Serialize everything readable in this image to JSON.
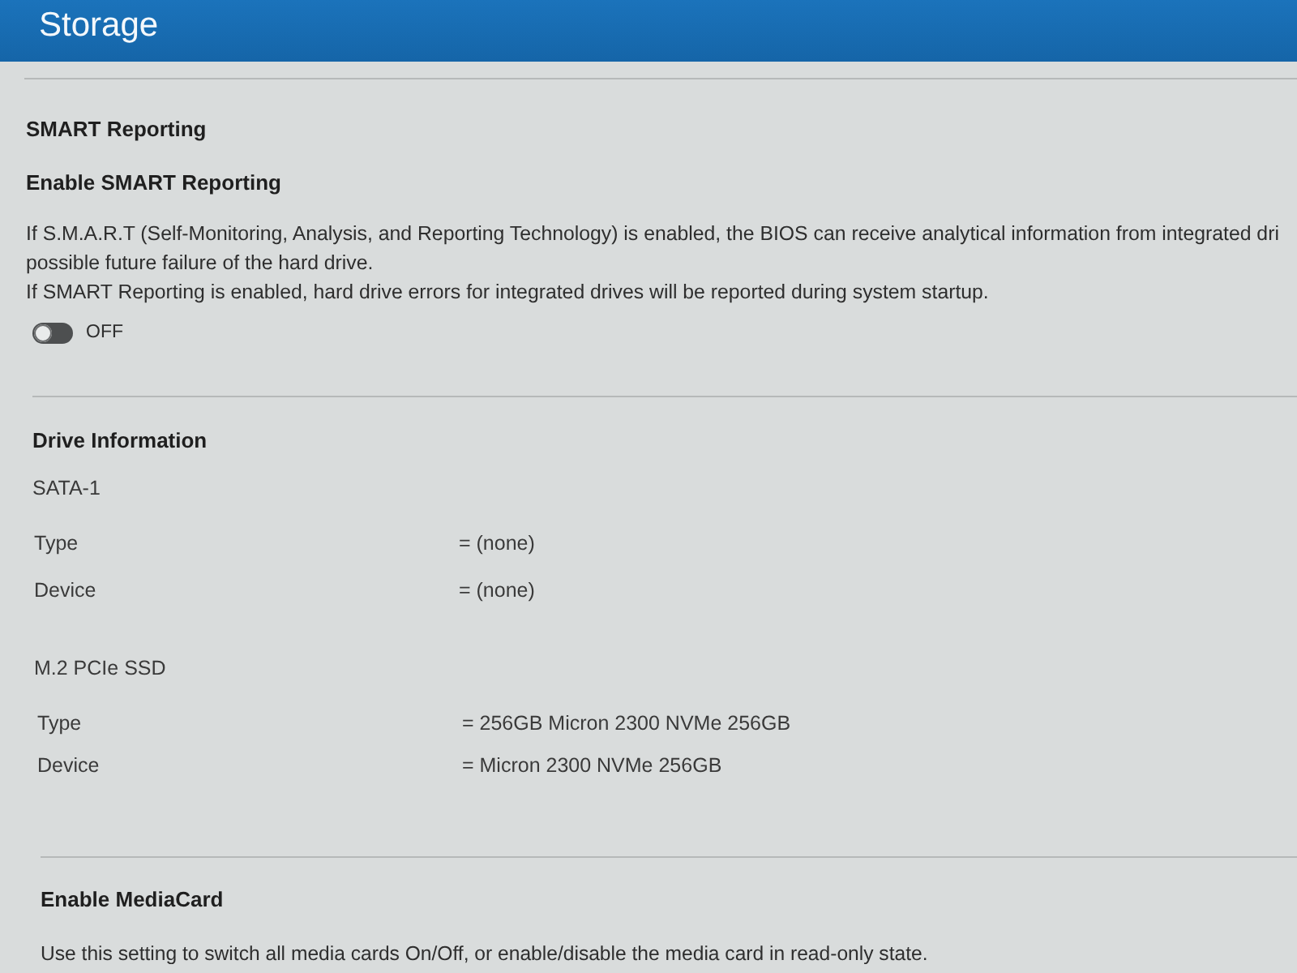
{
  "header": {
    "title": "Storage"
  },
  "smart_reporting": {
    "heading": "SMART Reporting",
    "setting": "Enable SMART Reporting",
    "description": [
      "If S.M.A.R.T (Self-Monitoring, Analysis, and Reporting Technology) is enabled, the BIOS can receive analytical information from integrated dri",
      "possible future failure of the hard drive.",
      "If SMART Reporting is enabled, hard drive errors for integrated drives will be reported during system startup."
    ],
    "toggle": {
      "on": false,
      "label": "OFF"
    }
  },
  "drive_information": {
    "heading": "Drive Information",
    "drives": [
      {
        "name": "SATA-1",
        "fields": [
          {
            "label": "Type",
            "value": "= (none)"
          },
          {
            "label": "Device",
            "value": "= (none)"
          }
        ]
      },
      {
        "name": "M.2 PCIe SSD",
        "fields": [
          {
            "label": "Type",
            "value": "= 256GB Micron 2300 NVMe 256GB"
          },
          {
            "label": "Device",
            "value": "= Micron 2300 NVMe 256GB"
          }
        ]
      }
    ]
  },
  "media_card": {
    "setting": "Enable MediaCard",
    "description": "Use this setting to switch all media cards On/Off, or enable/disable the media card in read-only state."
  }
}
